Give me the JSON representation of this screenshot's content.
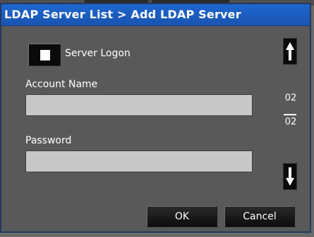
{
  "dialog": {
    "title": "LDAP Server List > Add LDAP Server",
    "server_logon_label": "Server Logon",
    "server_logon_checked": false,
    "account_name_label": "Account Name",
    "account_name_value": "",
    "password_label": "Password",
    "password_value": "",
    "page_current": "02",
    "page_total": "02",
    "ok_label": "OK",
    "cancel_label": "Cancel"
  },
  "icons": {
    "scroll_up": "arrow-up-icon",
    "scroll_down": "arrow-down-icon"
  },
  "colors": {
    "titlebar": "#1f67cf",
    "background": "#595959",
    "field": "#c7c7c7",
    "button": "#0c0c0c"
  }
}
